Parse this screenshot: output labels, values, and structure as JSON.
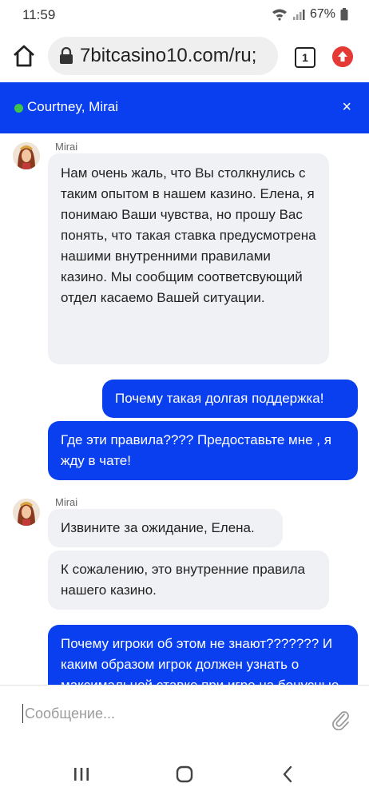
{
  "status_bar": {
    "time": "11:59",
    "battery": "67%"
  },
  "browser": {
    "url": "7bitcasino10.com/ru;",
    "tab_count": "1"
  },
  "chat_header": {
    "participants": "Courtney, Mirai",
    "close_label": "×",
    "online_color": "#3ec44a"
  },
  "messages": [
    {
      "sender": "Mirai",
      "role": "agent",
      "text": "Нам очень жаль, что Вы столкнулись с таким опытом в нашем казино. Елена, я понимаю Ваши чувства, но прошу Вас понять, что такая ставка предусмотрена нашими внутренними правилами казино. Мы сообщим соответсвующий отдел касаемо Вашей ситуации."
    },
    {
      "role": "user",
      "text": "Почему такая долгая поддержка!"
    },
    {
      "role": "user",
      "text": "Где эти правила???? Предоставьте мне , я жду в чате!"
    },
    {
      "sender": "Mirai",
      "role": "agent",
      "text": "Извините за ожидание, Елена."
    },
    {
      "role": "agent",
      "text": "К сожалению, это внутренние правила нашего казино."
    },
    {
      "role": "user",
      "text": "Почему игроки об этом не знают??????? И каким образом игрок должен узнать о максимальной ставке при игре на бонусные деньги?"
    }
  ],
  "composer": {
    "placeholder": "Сообщение..."
  },
  "colors": {
    "accent": "#0a3ff0",
    "agent_bubble": "#f0f1f4"
  },
  "icons": [
    "home-icon",
    "lock-icon",
    "tabs-icon",
    "extension-icon",
    "close-icon",
    "paperclip-icon",
    "recents-icon",
    "home-nav-icon",
    "back-icon",
    "wifi-icon",
    "signal-icon",
    "battery-icon"
  ]
}
